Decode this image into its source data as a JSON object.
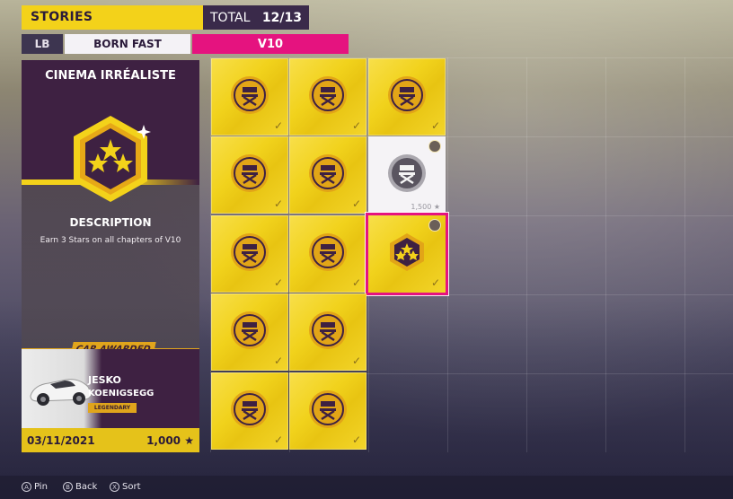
{
  "header": {
    "title": "STORIES",
    "total_label": "TOTAL",
    "total_value": "12/13"
  },
  "tabs": {
    "bumper": "LB",
    "prev": "BORN FAST",
    "active": "V10"
  },
  "detail": {
    "title": "CINEMA IRRÉALISTE",
    "description_title": "DESCRIPTION",
    "description": "Earn 3 Stars on all chapters of V10",
    "car_awarded_label": "CAR AWARDED",
    "car_model": "JESKO",
    "car_make": "KOENIGSEGG",
    "car_rarity": "LEGENDARY",
    "date": "03/11/2021",
    "points": "1,000"
  },
  "tiles": {
    "locked_cost": "1,500"
  },
  "footer": {
    "pin": "Pin",
    "pin_btn": "A",
    "back": "Back",
    "back_btn": "B",
    "sort": "Sort",
    "sort_btn": "X"
  },
  "colors": {
    "yellow": "#f3d21a",
    "pink": "#e5137f",
    "purple": "#3e2142"
  }
}
